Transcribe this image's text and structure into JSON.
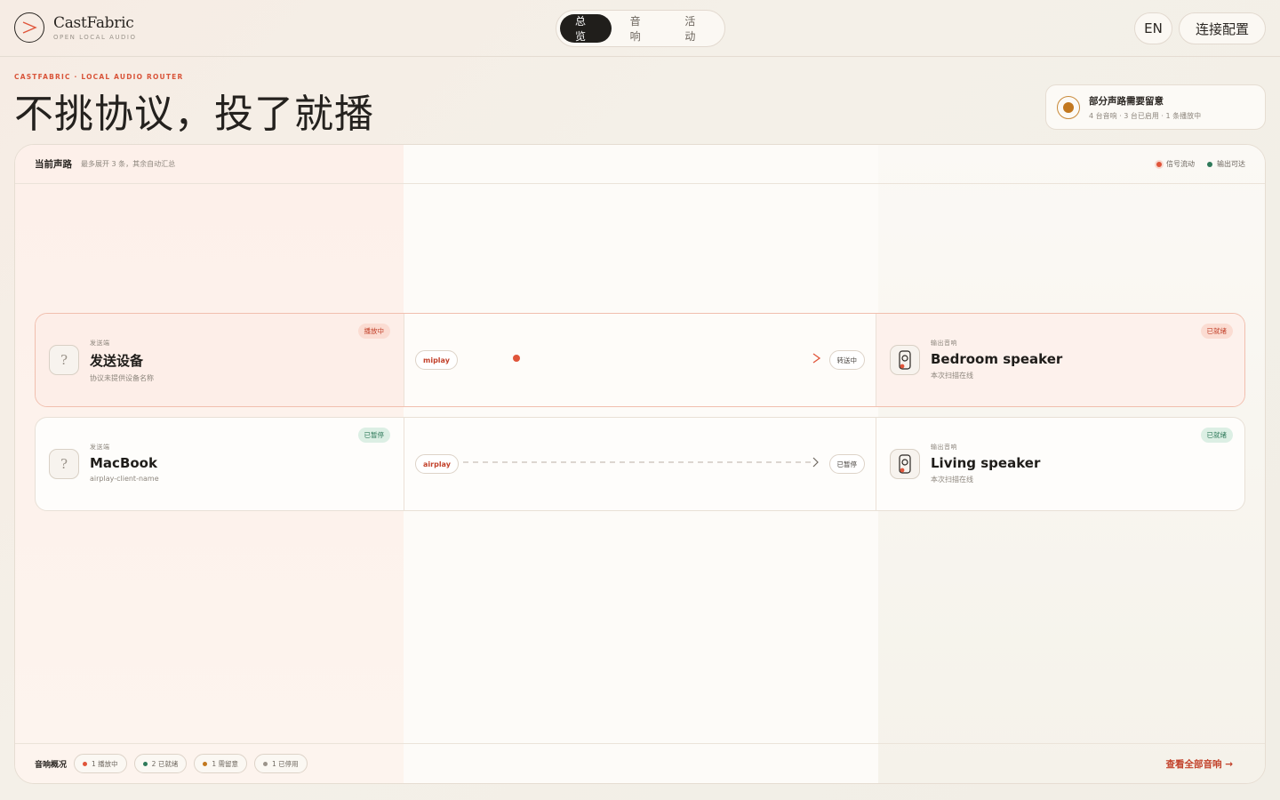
{
  "brand": {
    "name": "CastFabric",
    "subtitle": "OPEN LOCAL AUDIO"
  },
  "nav": {
    "tabs": [
      {
        "label": "总览",
        "active": true
      },
      {
        "label": "音响"
      },
      {
        "label": "活动"
      }
    ]
  },
  "header": {
    "lang_label": "EN",
    "connect_label": "连接配置"
  },
  "hero": {
    "eyebrow": "CASTFABRIC · LOCAL AUDIO ROUTER",
    "title": "不挑协议，投了就播"
  },
  "alert": {
    "title": "部分声路需要留意",
    "detail": "4 台音响 · 3 台已启用 · 1 条播放中"
  },
  "panel": {
    "title": "当前声路",
    "subtitle": "最多展开 3 条，其余自动汇总",
    "legend": [
      {
        "label": "信号流动",
        "color": "#e0553a"
      },
      {
        "label": "输出可达",
        "color": "#2f7a5a"
      }
    ]
  },
  "routes": [
    {
      "source": {
        "kicker": "发送端",
        "name": "发送设备",
        "desc": "协议未提供设备名称",
        "badge": "播放中",
        "icon": "question-icon"
      },
      "protocol": "miplay",
      "flow_state": "转送中",
      "progress": 0.15,
      "target": {
        "kicker": "输出音响",
        "name": "Bedroom speaker",
        "desc": "本次扫描在线",
        "badge": "已就绪",
        "icon": "speaker-icon"
      }
    },
    {
      "source": {
        "kicker": "发送端",
        "name": "MacBook",
        "desc": "airplay-client-name",
        "badge": "已暂停",
        "icon": "question-icon"
      },
      "protocol": "airplay",
      "flow_state": "已暂停",
      "target": {
        "kicker": "输出音响",
        "name": "Living speaker",
        "desc": "本次扫描在线",
        "badge": "已就绪",
        "icon": "speaker-icon"
      }
    }
  ],
  "footer": {
    "title": "音响概况",
    "chips": [
      {
        "label": "1 播放中",
        "color": "#e0553a"
      },
      {
        "label": "2 已就绪",
        "color": "#2f7a5a"
      },
      {
        "label": "1 需留意",
        "color": "#c2781f"
      },
      {
        "label": "1 已停用",
        "color": "#9b948b"
      }
    ],
    "view_all": "查看全部音响 →"
  },
  "colors": {
    "accent": "#e0553a",
    "ok": "#2f7a5a",
    "warn": "#c2781f"
  }
}
